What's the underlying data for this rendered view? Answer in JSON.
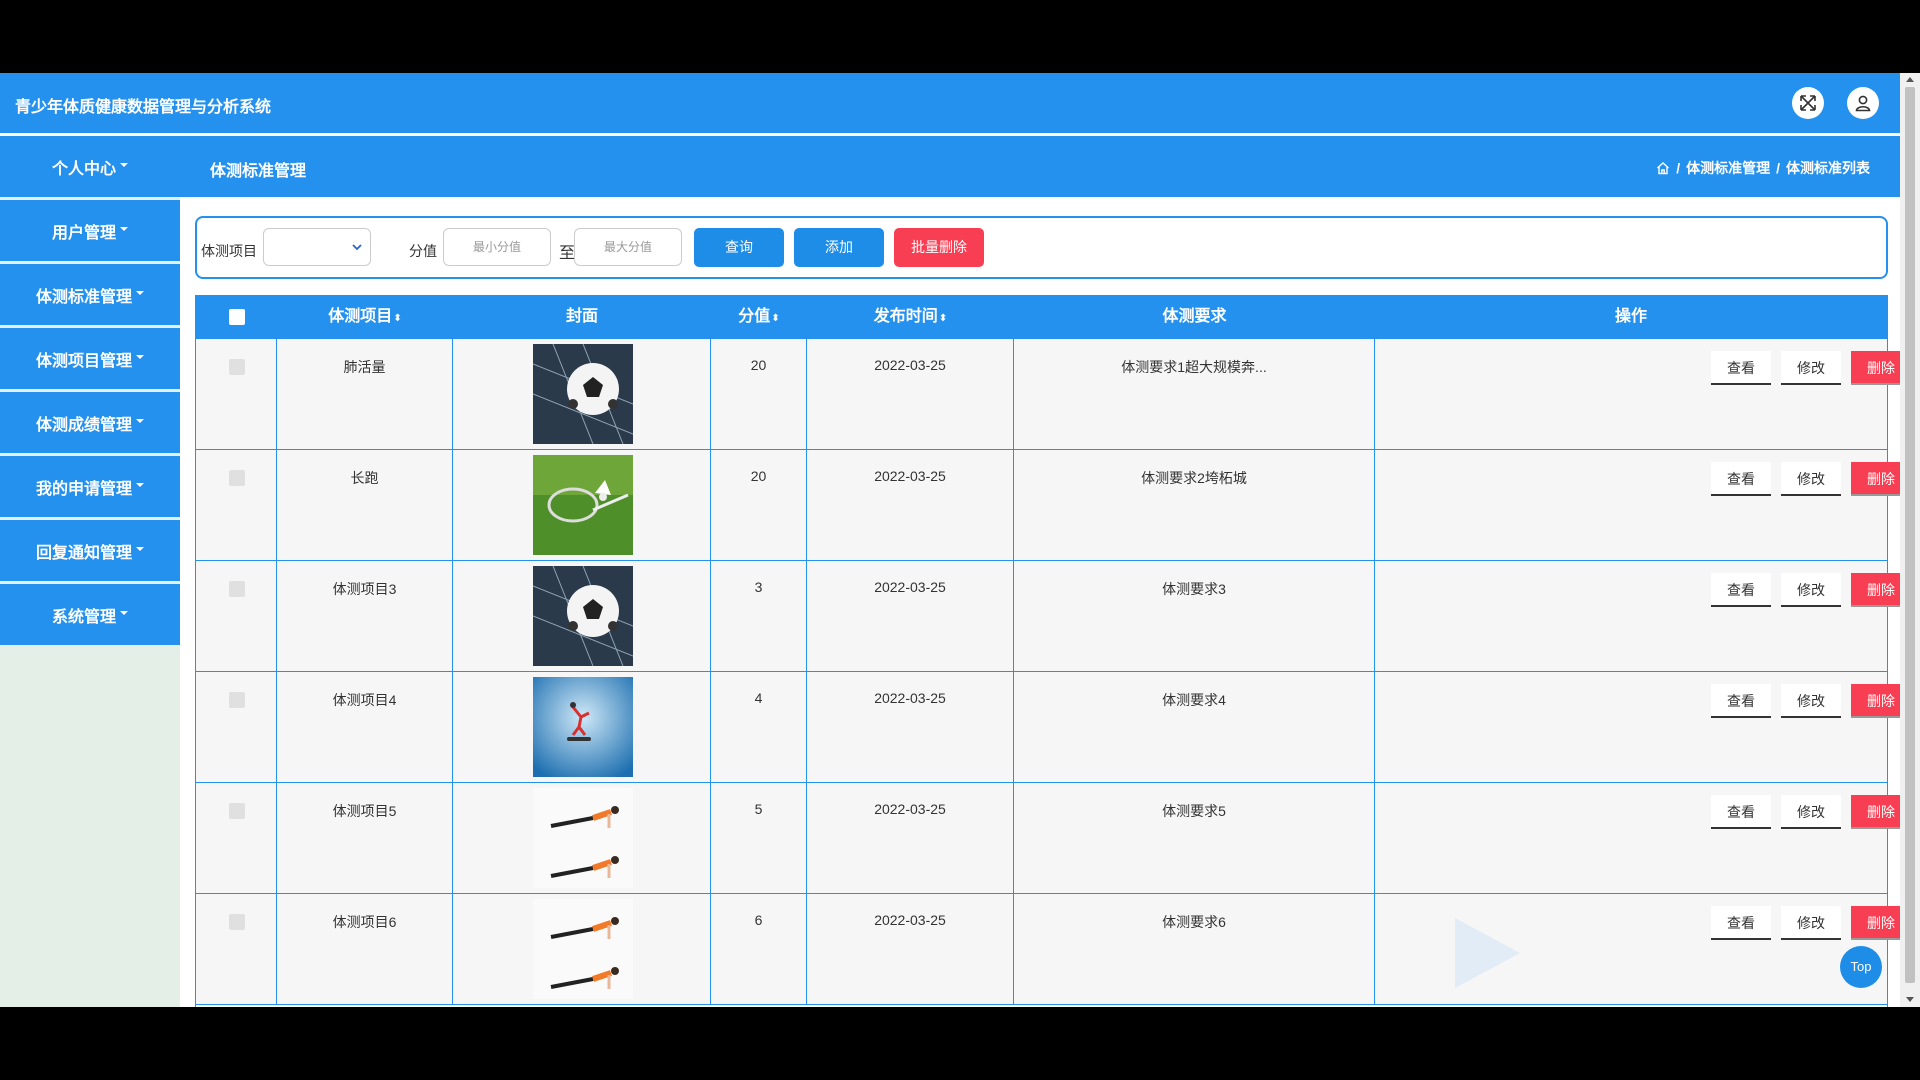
{
  "app": {
    "title": "青少年体质健康数据管理与分析系统"
  },
  "sidebar": {
    "items": [
      {
        "label": "个人中心"
      },
      {
        "label": "用户管理"
      },
      {
        "label": "体测标准管理"
      },
      {
        "label": "体测项目管理"
      },
      {
        "label": "体测成绩管理"
      },
      {
        "label": "我的申请管理"
      },
      {
        "label": "回复通知管理"
      },
      {
        "label": "系统管理"
      }
    ]
  },
  "header": {
    "page_title": "体测标准管理",
    "breadcrumb": {
      "sep": "/",
      "level1": "体测标准管理",
      "level2": "体测标准列表"
    }
  },
  "search": {
    "item_label": "体测项目",
    "item_value": "",
    "score_label": "分值",
    "min_placeholder": "最小分值",
    "to_label": "至",
    "max_placeholder": "最大分值",
    "query_label": "查询",
    "add_label": "添加",
    "batch_delete_label": "批量删除"
  },
  "colors": {
    "primary": "#2491ee",
    "danger": "#f73e52",
    "sidebar_bg": "#e4efe8"
  },
  "table": {
    "headers": {
      "item": "体测项目",
      "cover": "封面",
      "score": "分值",
      "date": "发布时间",
      "req": "体测要求",
      "ops": "操作"
    },
    "sort_icon": "⬍",
    "actions": {
      "view": "查看",
      "edit": "修改",
      "delete": "删除"
    },
    "rows": [
      {
        "item": "肺活量",
        "cover": "soccer-ball",
        "score": "20",
        "date": "2022-03-25",
        "req": "体测要求1超大规模奔..."
      },
      {
        "item": "长跑",
        "cover": "badminton",
        "score": "20",
        "date": "2022-03-25",
        "req": "体测要求2垮柘城"
      },
      {
        "item": "体测项目3",
        "cover": "soccer-ball",
        "score": "3",
        "date": "2022-03-25",
        "req": "体测要求3"
      },
      {
        "item": "体测项目4",
        "cover": "skateboard-jump",
        "score": "4",
        "date": "2022-03-25",
        "req": "体测要求4"
      },
      {
        "item": "体测项目5",
        "cover": "plank-exercise",
        "score": "5",
        "date": "2022-03-25",
        "req": "体测要求5"
      },
      {
        "item": "体测项目6",
        "cover": "plank-exercise",
        "score": "6",
        "date": "2022-03-25",
        "req": "体测要求6"
      }
    ]
  },
  "top_button": "Top"
}
